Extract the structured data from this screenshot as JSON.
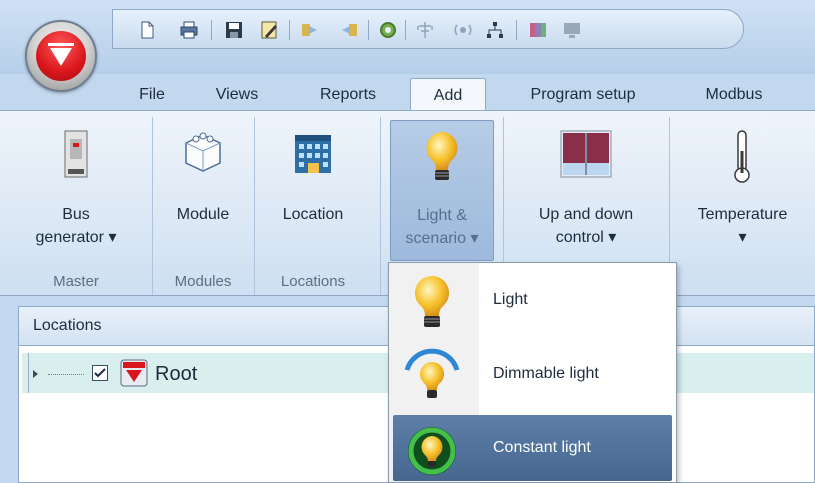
{
  "tabs": [
    {
      "label": "File",
      "active": false
    },
    {
      "label": "Views",
      "active": false
    },
    {
      "label": "Reports",
      "active": false
    },
    {
      "label": "Add",
      "active": true
    },
    {
      "label": "Program setup",
      "active": false
    },
    {
      "label": "Modbus",
      "active": false
    }
  ],
  "quick_access_icons": [
    "new-file-icon",
    "print-icon",
    "save-icon",
    "edit-document-icon",
    "forward-icon",
    "back-icon",
    "settings-icon",
    "antenna-icon",
    "wireless-icon",
    "network-icon",
    "palette-icon",
    "monitor-icon"
  ],
  "ribbon": {
    "buttons": [
      {
        "line1": "Bus",
        "line2": "generator ▾",
        "icon": "bus-generator-icon"
      },
      {
        "line1": "Module",
        "line2": "",
        "icon": "module-icon"
      },
      {
        "line1": "Location",
        "line2": "",
        "icon": "building-icon"
      },
      {
        "line1": "Light &",
        "line2": "scenario ▾",
        "icon": "light-bulb-icon"
      },
      {
        "line1": "Up and down",
        "line2": "control ▾",
        "icon": "window-blind-icon"
      },
      {
        "line1": "Temperature",
        "line2": "▾",
        "icon": "thermometer-icon"
      }
    ],
    "groups": [
      "Master",
      "Modules",
      "Locations"
    ]
  },
  "panel": {
    "title": "Locations",
    "tree": {
      "label": "Root",
      "checked": true
    }
  },
  "dropdown": {
    "items": [
      {
        "label": "Light",
        "icon": "light-bulb-icon",
        "highlighted": false
      },
      {
        "label": "Dimmable light",
        "icon": "dimmable-light-icon",
        "highlighted": false
      },
      {
        "label": "Constant light",
        "icon": "constant-light-icon",
        "highlighted": true
      }
    ]
  },
  "colors": {
    "accent": "#46668f",
    "ribbon_bg": "#dce8f5",
    "brand_red": "#d9161c"
  }
}
